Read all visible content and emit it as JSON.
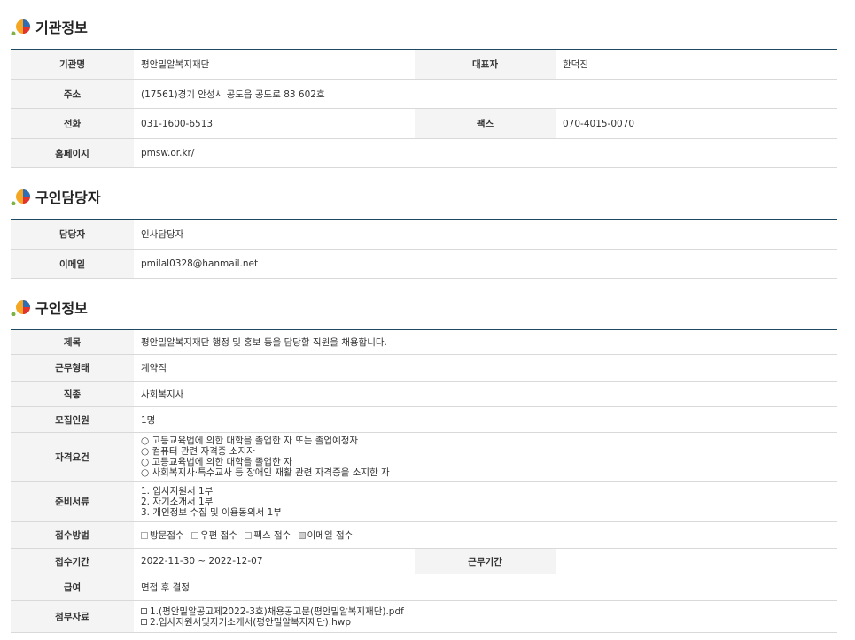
{
  "sections": {
    "org": {
      "title": "기관정보"
    },
    "contact": {
      "title": "구인담당자"
    },
    "job": {
      "title": "구인정보"
    }
  },
  "org": {
    "name_label": "기관명",
    "name": "평안밀알복지재단",
    "rep_label": "대표자",
    "rep": "한덕진",
    "addr_label": "주소",
    "addr": "(17561)경기 안성시 공도읍 공도로 83 602호",
    "tel_label": "전화",
    "tel": "031-1600-6513",
    "fax_label": "팩스",
    "fax": "070-4015-0070",
    "home_label": "홈페이지",
    "home": "pmsw.or.kr/"
  },
  "contact": {
    "person_label": "담당자",
    "person": "인사담당자",
    "email_label": "이메일",
    "email": "pmilal0328@hanmail.net"
  },
  "job": {
    "subject_label": "제목",
    "subject": "평안밀알복지재단 행정 및 홍보 등을 담당할 직원을 채용합니다.",
    "type_label": "근무형태",
    "type": "계약직",
    "occupation_label": "직종",
    "occupation": "사회복지사",
    "headcount_label": "모집인원",
    "headcount": "1명",
    "qual_label": "자격요건",
    "qualifications": [
      "○ 고등교육법에 의한 대학을 졸업한 자 또는 졸업예정자",
      "○ 컴퓨터 관련 자격증 소지자",
      "○ 고등교육법에 의한 대학을 졸업한 자",
      "○ 사회복지사·특수교사 등 장애인 재활 관련 자격증을 소지한 자"
    ],
    "docs_label": "준비서류",
    "documents": [
      "1. 입사지원서 1부",
      "2. 자기소개서 1부",
      "3. 개인정보 수집 및 이용동의서 1부"
    ],
    "method_label": "접수방법",
    "methods": [
      {
        "label": "방문접수",
        "checked": false
      },
      {
        "label": "우편 접수",
        "checked": false
      },
      {
        "label": "팩스 접수",
        "checked": false
      },
      {
        "label": "이메일 접수",
        "checked": true
      }
    ],
    "period_label": "접수기간",
    "period": "2022-11-30 ~ 2022-12-07",
    "workperiod_label": "근무기간",
    "workperiod": "",
    "salary_label": "급여",
    "salary": "면접 후 결정",
    "attach_label": "첨부자료",
    "attachments": [
      "1.(평안밀알공고제2022-3호)채용공고문(평안밀알복지재단).pdf",
      "2.입사지원서및자기소개서(평안밀알복지재단).hwp"
    ]
  }
}
